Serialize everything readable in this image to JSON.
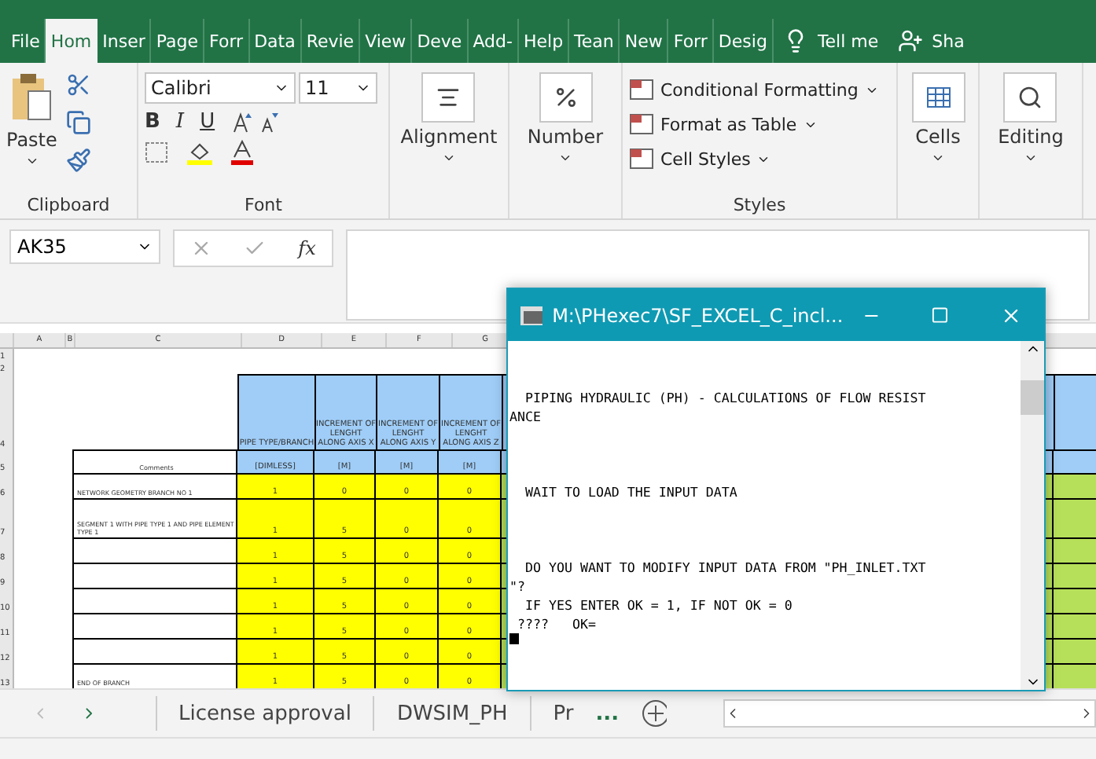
{
  "ribbon_tabs": [
    {
      "label": "File",
      "selected": false
    },
    {
      "label": "Hom",
      "selected": true
    },
    {
      "label": "Inser",
      "selected": false
    },
    {
      "label": "Page",
      "selected": false
    },
    {
      "label": "Forr",
      "selected": false
    },
    {
      "label": "Data",
      "selected": false
    },
    {
      "label": "Revie",
      "selected": false
    },
    {
      "label": "View",
      "selected": false
    },
    {
      "label": "Deve",
      "selected": false
    },
    {
      "label": "Add-",
      "selected": false
    },
    {
      "label": "Help",
      "selected": false
    },
    {
      "label": "Tean",
      "selected": false
    },
    {
      "label": "New",
      "selected": false
    },
    {
      "label": "Forr",
      "selected": false
    },
    {
      "label": "Desig",
      "selected": false
    }
  ],
  "tell_me": "Tell me",
  "share": "Sha",
  "ribbon": {
    "clipboard": {
      "paste": "Paste",
      "label": "Clipboard"
    },
    "font": {
      "name": "Calibri",
      "size": "11",
      "bold": "B",
      "italic": "I",
      "underline": "U",
      "label": "Font"
    },
    "alignment": "Alignment",
    "number": "Number",
    "styles": {
      "items": [
        "Conditional Formatting",
        "Format as Table",
        "Cell Styles"
      ],
      "label": "Styles"
    },
    "cells": "Cells",
    "editing": "Editing"
  },
  "formula_bar": {
    "name_box": "AK35",
    "fx": "fx"
  },
  "sheet": {
    "columns": [
      "A",
      "B",
      "C",
      "D",
      "E",
      "F",
      "G"
    ],
    "header": {
      "row": "4",
      "cells": [
        "PIPE TYPE/BRANCH",
        "INCREMENT OF LENGHT ALONG AXIS X",
        "INCREMENT OF LENGHT ALONG AXIS Y",
        "INCREMENT OF LENGHT ALONG AXIS Z"
      ]
    },
    "units": {
      "row": "5",
      "comment": "Comments",
      "cells": [
        "[DIMLESS]",
        "[M]",
        "[M]",
        "[M]"
      ]
    },
    "rows": [
      {
        "row": "6",
        "comment": "NETWORK GEOMETRY BRANCH NO 1",
        "cells": [
          "1",
          "0",
          "0",
          "0"
        ]
      },
      {
        "row": "7",
        "comment": "SEGMENT 1 WITH PIPE TYPE 1 AND PIPE ELEMENT TYPE 1",
        "cells": [
          "1",
          "5",
          "0",
          "0"
        ]
      },
      {
        "row": "8",
        "cells": [
          "1",
          "5",
          "0",
          "0"
        ]
      },
      {
        "row": "9",
        "cells": [
          "1",
          "5",
          "0",
          "0"
        ]
      },
      {
        "row": "10",
        "cells": [
          "1",
          "5",
          "0",
          "0"
        ]
      },
      {
        "row": "11",
        "cells": [
          "1",
          "5",
          "0",
          "0"
        ]
      },
      {
        "row": "12",
        "cells": [
          "1",
          "5",
          "0",
          "0"
        ]
      },
      {
        "row": "13",
        "comment": "END OF BRANCH",
        "cells": [
          "1",
          "5",
          "0",
          "0"
        ]
      }
    ],
    "top_rows": [
      "1",
      "2"
    ]
  },
  "sheet_tabs": [
    "License approval",
    "DWSIM_PH",
    "Pr"
  ],
  "more_tabs": "...",
  "console": {
    "title": "M:\\PHexec7\\SF_EXCEL_C_incl...",
    "paragraphs": [
      [
        "  PIPING HYDRAULIC (PH) - CALCULATIONS OF FLOW RESIST",
        "ANCE"
      ],
      [
        "  WAIT TO LOAD THE INPUT DATA"
      ],
      [
        "  DO YOU WANT TO MODIFY INPUT DATA FROM \"PH_INLET.TXT",
        "\"?",
        "  IF YES ENTER OK = 1, IF NOT OK = 0",
        " ????   OK="
      ]
    ]
  }
}
